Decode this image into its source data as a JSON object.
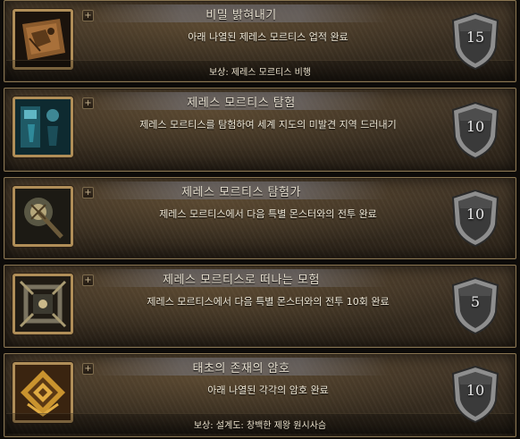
{
  "achievements": [
    {
      "title": "비밀 밝혀내기",
      "description": "아래 나열된 제레스 모르티스 업적 완료",
      "reward": "보상: 제레스 모르티스 비행",
      "points": "15",
      "icon": "map-icon"
    },
    {
      "title": "제레스 모르티스 탐험",
      "description": "제레스 모르티스를 탐험하여 세계 지도의 미발견 지역 드러내기",
      "reward": "",
      "points": "10",
      "icon": "explore-icon"
    },
    {
      "title": "제레스 모르티스 탐험가",
      "description": "제레스 모르티스에서 다음 특별 몬스터와의 전투 완료",
      "reward": "",
      "points": "10",
      "icon": "mace-icon"
    },
    {
      "title": "제레스 모르티스로 떠나는 모험",
      "description": "제레스 모르티스에서 다음 특별 몬스터와의 전투 10회 완료",
      "reward": "",
      "points": "5",
      "icon": "frame-icon"
    },
    {
      "title": "태초의 존재의 암호",
      "description": "아래 나열된 각각의 암호 완료",
      "reward": "보상: 설계도: 창백한 제왕 원시사슴",
      "points": "10",
      "icon": "glyph-icon"
    }
  ],
  "expand_symbol": "+"
}
